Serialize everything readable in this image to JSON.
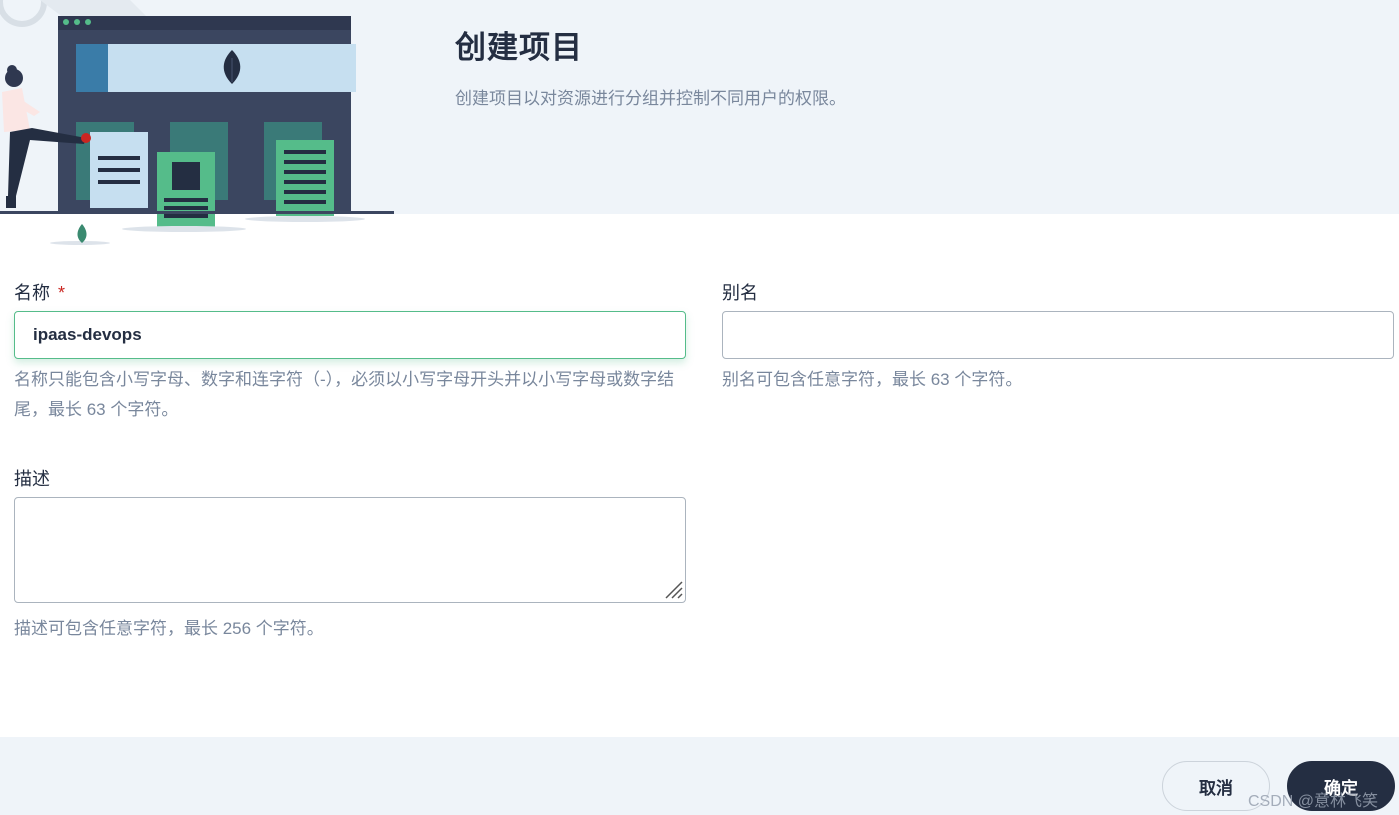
{
  "header": {
    "title": "创建项目",
    "subtitle": "创建项目以对资源进行分组并控制不同用户的权限。"
  },
  "form": {
    "name": {
      "label": "名称",
      "required_mark": "*",
      "value": "ipaas-devops",
      "hint": "名称只能包含小写字母、数字和连字符（-），必须以小写字母开头并以小写字母或数字结尾，最长 63 个字符。"
    },
    "alias": {
      "label": "别名",
      "value": "",
      "hint": "别名可包含任意字符，最长 63 个字符。"
    },
    "description": {
      "label": "描述",
      "value": "",
      "hint": "描述可包含任意字符，最长 256 个字符。"
    }
  },
  "footer": {
    "cancel_label": "取消",
    "ok_label": "确定"
  },
  "watermark": "CSDN @意林飞笑",
  "colors": {
    "header_bg": "#eff4f9",
    "text_primary": "#242e42",
    "text_secondary": "#79879c",
    "accent_green": "#55bc8a",
    "required_red": "#ca2621",
    "button_dark": "#242e42"
  },
  "icons": [
    "project-illustration",
    "leaf-icon",
    "document-icon",
    "resize-handle-icon"
  ]
}
